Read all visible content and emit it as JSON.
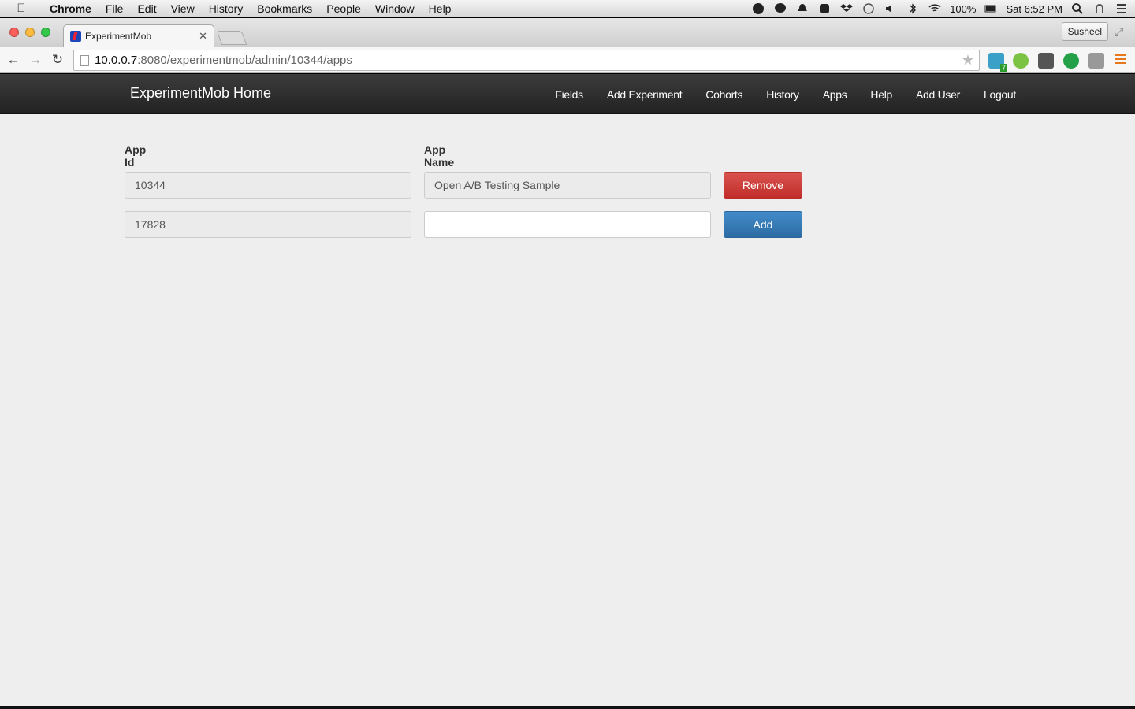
{
  "menubar": {
    "app": "Chrome",
    "items": [
      "File",
      "Edit",
      "View",
      "History",
      "Bookmarks",
      "People",
      "Window",
      "Help"
    ],
    "battery": "100%",
    "clock": "Sat 6:52 PM"
  },
  "browser": {
    "tab_title": "ExperimentMob",
    "profile": "Susheel",
    "url_host": "10.0.0.7",
    "url_path": ":8080/experimentmob/admin/10344/apps",
    "extension_badge": "7"
  },
  "page": {
    "brand": "ExperimentMob Home",
    "nav": [
      "Fields",
      "Add Experiment",
      "Cohorts",
      "History",
      "Apps",
      "Help",
      "Add User",
      "Logout"
    ],
    "columns": {
      "app_id": "App Id",
      "app_name": "App Name"
    },
    "rows": [
      {
        "app_id": "10344",
        "app_name": "Open A/B Testing Sample",
        "action": "Remove"
      },
      {
        "app_id": "17828",
        "app_name": "",
        "action": "Add"
      }
    ]
  }
}
